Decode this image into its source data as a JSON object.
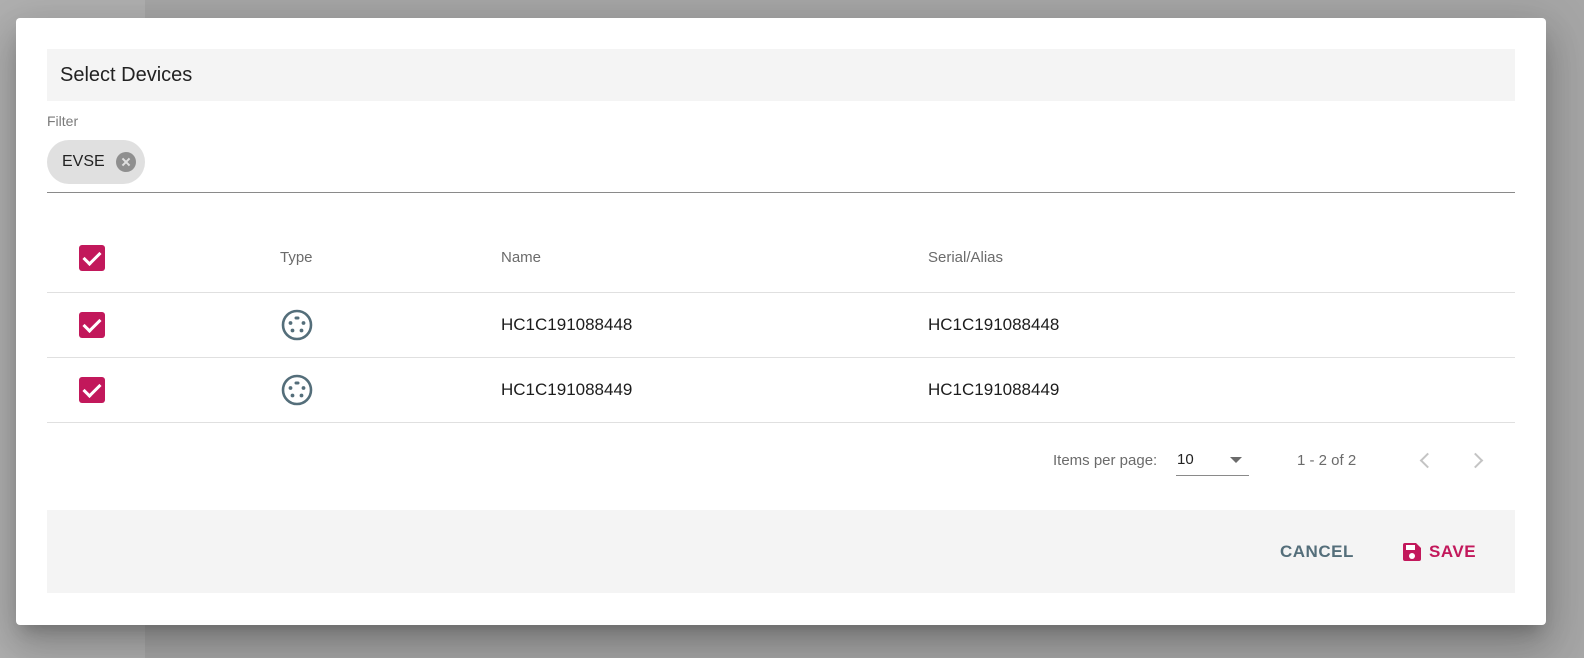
{
  "dialog": {
    "title": "Select Devices"
  },
  "filter": {
    "label": "Filter",
    "chips": [
      {
        "label": "EVSE"
      }
    ]
  },
  "table": {
    "columns": {
      "type": "Type",
      "name": "Name",
      "serial": "Serial/Alias"
    },
    "select_all_checked": true,
    "rows": [
      {
        "checked": true,
        "type_icon": "ev-connector-icon",
        "name": "HC1C191088448",
        "serial": "HC1C191088448"
      },
      {
        "checked": true,
        "type_icon": "ev-connector-icon",
        "name": "HC1C191088449",
        "serial": "HC1C191088449"
      }
    ]
  },
  "paginator": {
    "items_per_page_label": "Items per page:",
    "page_size": "10",
    "range_label": "1 - 2 of 2"
  },
  "actions": {
    "cancel_label": "CANCEL",
    "save_label": "SAVE"
  },
  "colors": {
    "accent": "#c2185b",
    "cancel": "#546e7a"
  }
}
